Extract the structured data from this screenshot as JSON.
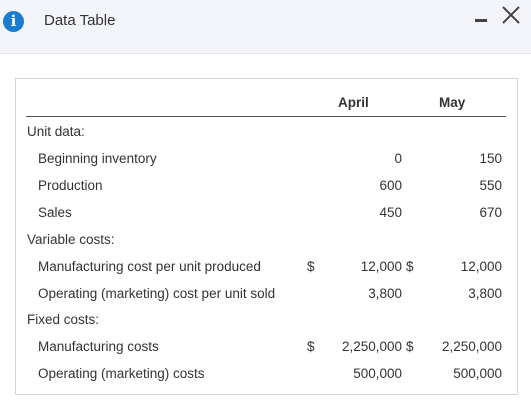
{
  "dialog": {
    "title": "Data Table",
    "info_icon": "info-icon",
    "minimize_icon": "minimize-icon",
    "close_icon": "close-icon"
  },
  "table": {
    "columns": [
      "April",
      "May"
    ],
    "sections": {
      "unit_data": "Unit data:",
      "variable_costs": "Variable costs:",
      "fixed_costs": "Fixed costs:"
    },
    "rows": [
      {
        "label": "Beginning inventory",
        "april": "0",
        "may": "150"
      },
      {
        "label": "Production",
        "april": "600",
        "may": "550"
      },
      {
        "label": "Sales",
        "april": "450",
        "may": "670"
      },
      {
        "label": "Manufacturing cost per unit produced",
        "april_sym": "$",
        "april": "12,000",
        "may_sym": "$",
        "may": "12,000"
      },
      {
        "label": "Operating (marketing) cost per unit sold",
        "april": "3,800",
        "may": "3,800"
      },
      {
        "label": "Manufacturing costs",
        "april_sym": "$",
        "april": "2,250,000",
        "may_sym": "$",
        "may": "2,250,000"
      },
      {
        "label": "Operating (marketing) costs",
        "april": "500,000",
        "may": "500,000"
      }
    ]
  }
}
